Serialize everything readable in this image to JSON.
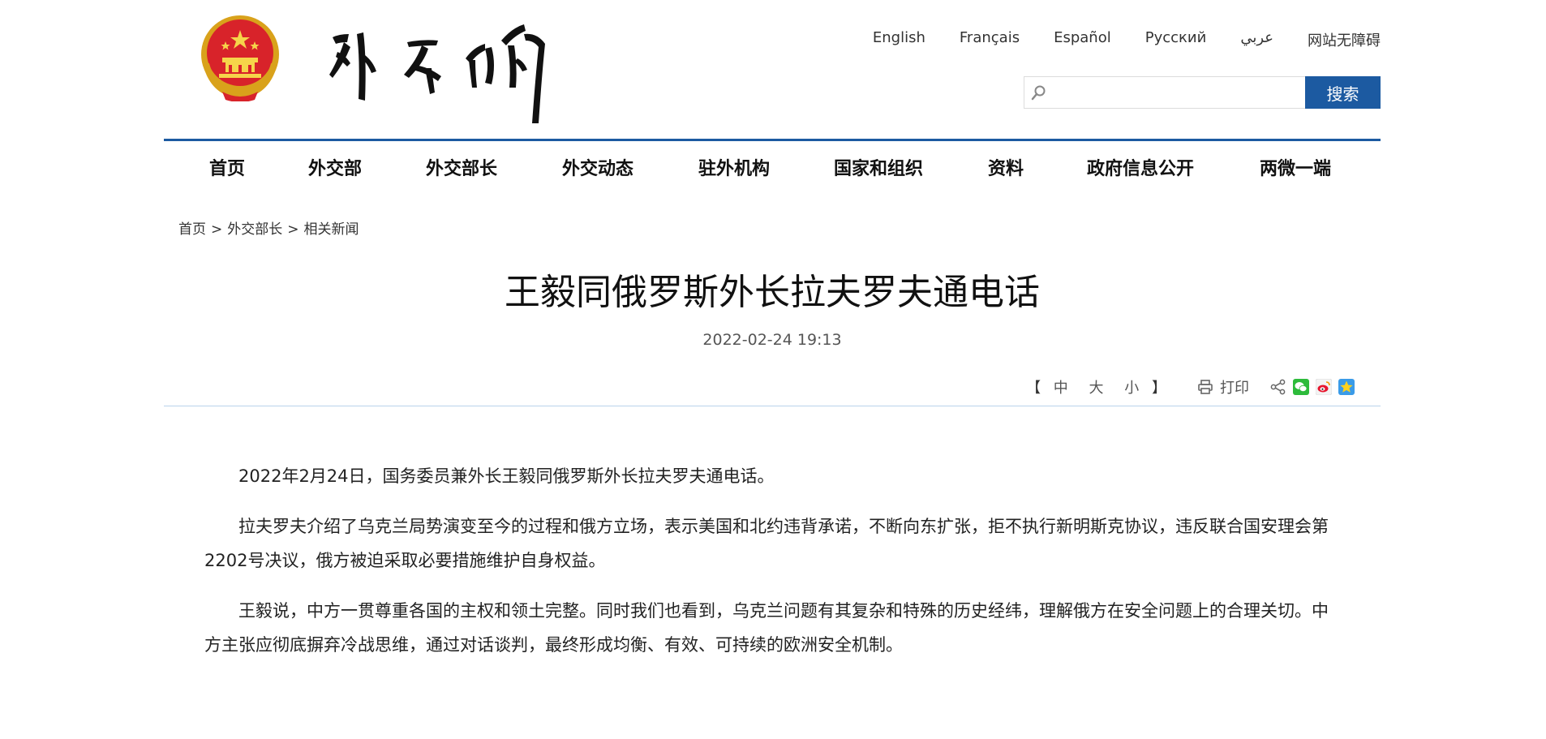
{
  "header": {
    "languages": [
      "English",
      "Français",
      "Español",
      "Русский",
      "عربي",
      "网站无障碍"
    ],
    "search": {
      "placeholder": "",
      "button": "搜索"
    }
  },
  "nav": [
    "首页",
    "外交部",
    "外交部长",
    "外交动态",
    "驻外机构",
    "国家和组织",
    "资料",
    "政府信息公开",
    "两微一端"
  ],
  "breadcrumb": [
    "首页",
    "外交部长",
    "相关新闻"
  ],
  "article": {
    "title": "王毅同俄罗斯外长拉夫罗夫通电话",
    "date": "2022-02-24 19:13",
    "tools": {
      "bracket_open": "【",
      "size_large": "中",
      "size_medium": "大",
      "size_small": "小",
      "bracket_close": "】",
      "print": "打印"
    },
    "paragraphs": [
      "2022年2月24日，国务委员兼外长王毅同俄罗斯外长拉夫罗夫通电话。",
      "拉夫罗夫介绍了乌克兰局势演变至今的过程和俄方立场，表示美国和北约违背承诺，不断向东扩张，拒不执行新明斯克协议，违反联合国安理会第2202号决议，俄方被迫采取必要措施维护自身权益。",
      "王毅说，中方一贯尊重各国的主权和领土完整。同时我们也看到，乌克兰问题有其复杂和特殊的历史经纬，理解俄方在安全问题上的合理关切。中方主张应彻底摒弃冷战思维，通过对话谈判，最终形成均衡、有效、可持续的欧洲安全机制。"
    ]
  },
  "colors": {
    "accent": "#1c5aa1",
    "divider": "#b9d3ec"
  }
}
